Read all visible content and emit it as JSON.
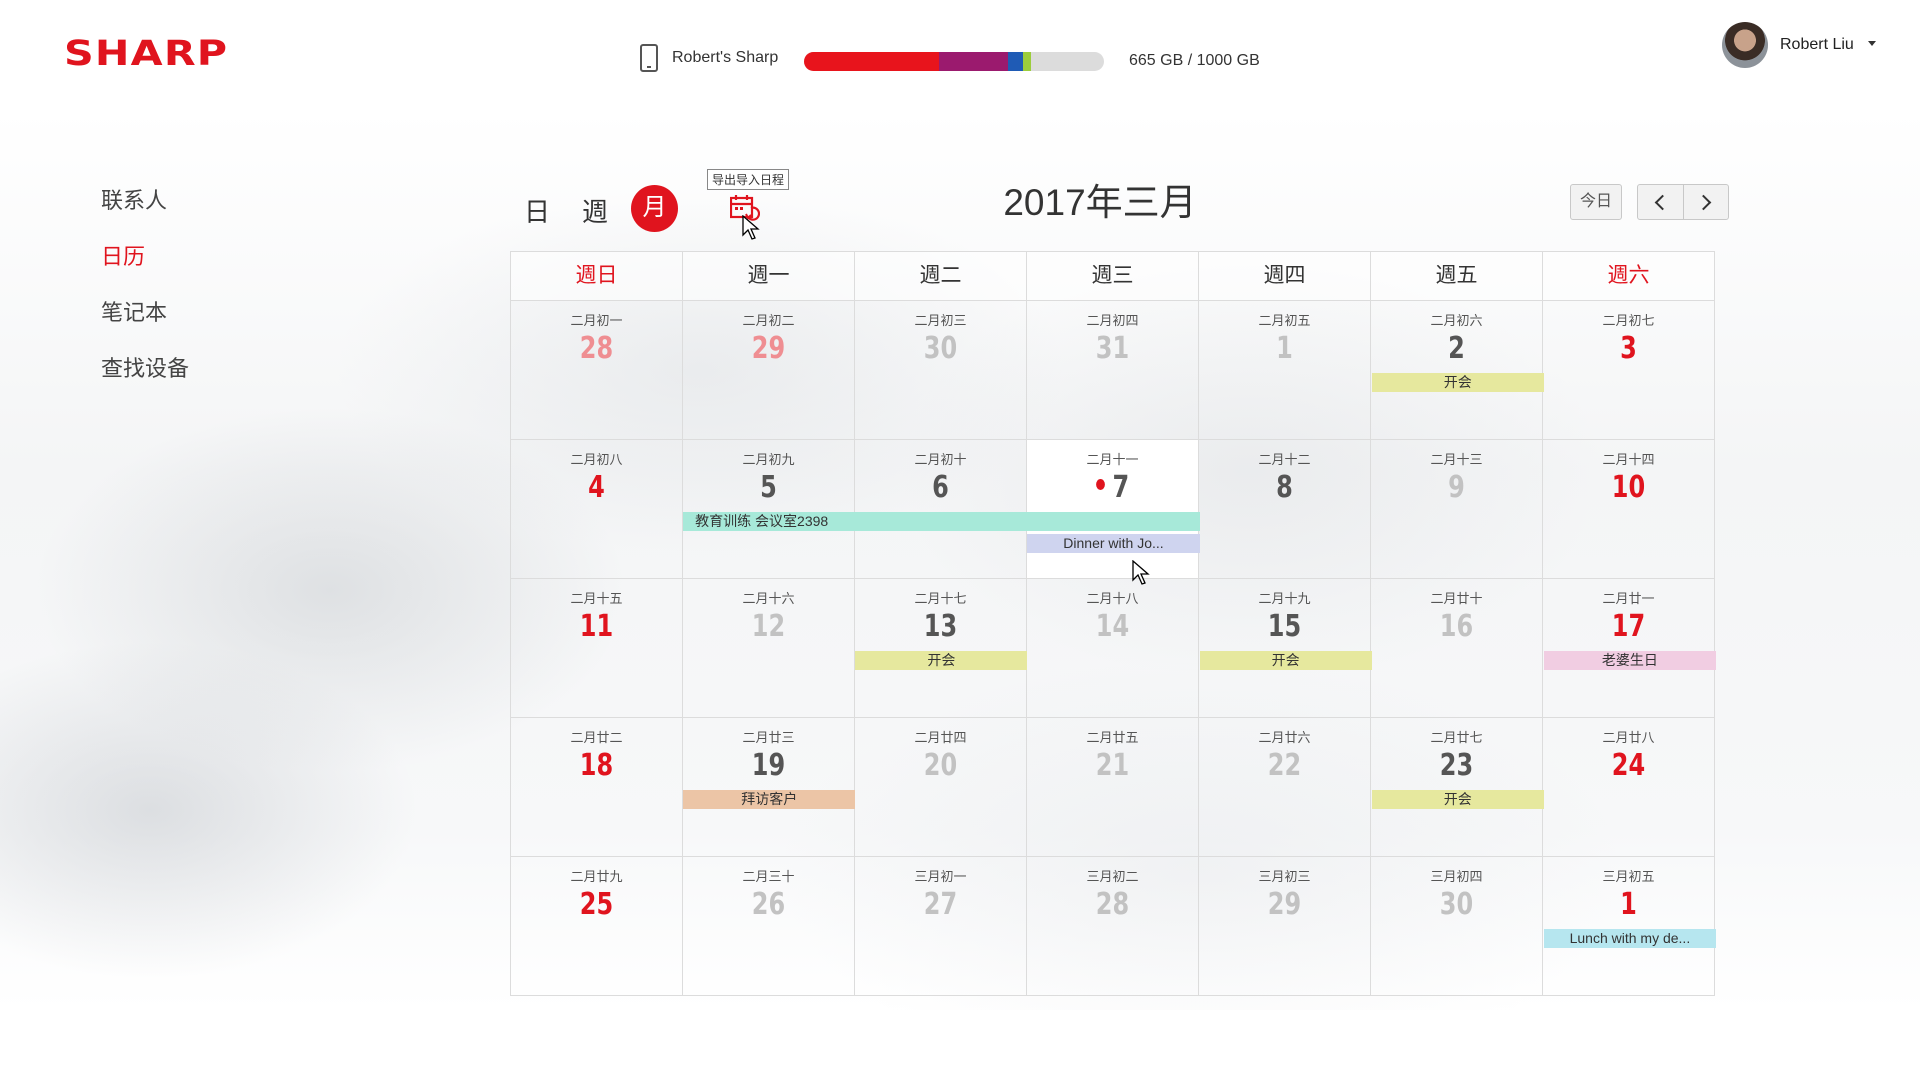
{
  "header": {
    "brand": "SHARP",
    "device_name": "Robert's Sharp",
    "storage_text": "665 GB / 1000 GB",
    "storage_used_fraction": 0.665,
    "storage_segments": [
      {
        "color": "#e8141c",
        "fraction": 0.45
      },
      {
        "color": "#9b1a6e",
        "fraction": 0.23
      },
      {
        "color": "#1f5bb5",
        "fraction": 0.05
      },
      {
        "color": "#9ccd3c",
        "fraction": 0.025
      }
    ],
    "user_name": "Robert Liu"
  },
  "sidebar": {
    "items": [
      {
        "label": "联系人",
        "active": false
      },
      {
        "label": "日历",
        "active": true
      },
      {
        "label": "笔记本",
        "active": false
      },
      {
        "label": "查找设备",
        "active": false
      }
    ]
  },
  "toolbar": {
    "view_day": "日",
    "view_week": "週",
    "view_month": "月",
    "export_tooltip": "导出导入日程",
    "title": "2017年三月",
    "today_label": "今日"
  },
  "weekdays": [
    "週日",
    "週一",
    "週二",
    "週三",
    "週四",
    "週五",
    "週六"
  ],
  "weeks": [
    [
      {
        "lunar": "二月初一",
        "day": "28",
        "style": "pinkfade"
      },
      {
        "lunar": "二月初二",
        "day": "29",
        "style": "pinkfade"
      },
      {
        "lunar": "二月初三",
        "day": "30",
        "style": "gray"
      },
      {
        "lunar": "二月初四",
        "day": "31",
        "style": "gray"
      },
      {
        "lunar": "二月初五",
        "day": "1",
        "style": "gray"
      },
      {
        "lunar": "二月初六",
        "day": "2",
        "style": "dark"
      },
      {
        "lunar": "二月初七",
        "day": "3",
        "style": "red"
      }
    ],
    [
      {
        "lunar": "二月初八",
        "day": "4",
        "style": "red"
      },
      {
        "lunar": "二月初九",
        "day": "5",
        "style": "dark"
      },
      {
        "lunar": "二月初十",
        "day": "6",
        "style": "dark"
      },
      {
        "lunar": "二月十一",
        "day": "7",
        "style": "dark",
        "today": true
      },
      {
        "lunar": "二月十二",
        "day": "8",
        "style": "dark"
      },
      {
        "lunar": "二月十三",
        "day": "9",
        "style": "gray"
      },
      {
        "lunar": "二月十四",
        "day": "10",
        "style": "red"
      }
    ],
    [
      {
        "lunar": "二月十五",
        "day": "11",
        "style": "red"
      },
      {
        "lunar": "二月十六",
        "day": "12",
        "style": "gray"
      },
      {
        "lunar": "二月十七",
        "day": "13",
        "style": "dark"
      },
      {
        "lunar": "二月十八",
        "day": "14",
        "style": "gray"
      },
      {
        "lunar": "二月十九",
        "day": "15",
        "style": "dark"
      },
      {
        "lunar": "二月廿十",
        "day": "16",
        "style": "gray"
      },
      {
        "lunar": "二月廿一",
        "day": "17",
        "style": "red"
      }
    ],
    [
      {
        "lunar": "二月廿二",
        "day": "18",
        "style": "red"
      },
      {
        "lunar": "二月廿三",
        "day": "19",
        "style": "dark"
      },
      {
        "lunar": "二月廿四",
        "day": "20",
        "style": "gray"
      },
      {
        "lunar": "二月廿五",
        "day": "21",
        "style": "gray"
      },
      {
        "lunar": "二月廿六",
        "day": "22",
        "style": "gray"
      },
      {
        "lunar": "二月廿七",
        "day": "23",
        "style": "dark"
      },
      {
        "lunar": "二月廿八",
        "day": "24",
        "style": "red"
      }
    ],
    [
      {
        "lunar": "二月廿九",
        "day": "25",
        "style": "red"
      },
      {
        "lunar": "二月三十",
        "day": "26",
        "style": "gray"
      },
      {
        "lunar": "三月初一",
        "day": "27",
        "style": "gray"
      },
      {
        "lunar": "三月初二",
        "day": "28",
        "style": "gray"
      },
      {
        "lunar": "三月初三",
        "day": "29",
        "style": "gray"
      },
      {
        "lunar": "三月初四",
        "day": "30",
        "style": "gray"
      },
      {
        "lunar": "三月初五",
        "day": "1",
        "style": "red"
      }
    ]
  ],
  "events": [
    {
      "week": 0,
      "start": 5,
      "span": 1,
      "slot": 0,
      "label": "开会",
      "color": "#e6e89e",
      "align": "center"
    },
    {
      "week": 1,
      "start": 1,
      "span": 3,
      "slot": 0,
      "label": "教育训练 会议室2398",
      "color": "#a7e9d9",
      "align": "left"
    },
    {
      "week": 1,
      "start": 3,
      "span": 1,
      "slot": 1,
      "label": "Dinner with Jo...",
      "color": "#cfd4ef",
      "align": "center"
    },
    {
      "week": 2,
      "start": 2,
      "span": 1,
      "slot": 0,
      "label": "开会",
      "color": "#e6e89e",
      "align": "center"
    },
    {
      "week": 2,
      "start": 4,
      "span": 1,
      "slot": 0,
      "label": "开会",
      "color": "#e6e89e",
      "align": "center"
    },
    {
      "week": 2,
      "start": 6,
      "span": 1,
      "slot": 0,
      "label": "老婆生日",
      "color": "#f1cde2",
      "align": "center"
    },
    {
      "week": 3,
      "start": 1,
      "span": 1,
      "slot": 0,
      "label": "拜访客户",
      "color": "#ecc5a6",
      "align": "center"
    },
    {
      "week": 3,
      "start": 5,
      "span": 1,
      "slot": 0,
      "label": "开会",
      "color": "#e6e89e",
      "align": "center"
    },
    {
      "week": 4,
      "start": 6,
      "span": 1,
      "slot": 0,
      "label": "Lunch with my de...",
      "color": "#b6e6ef",
      "align": "center"
    }
  ]
}
